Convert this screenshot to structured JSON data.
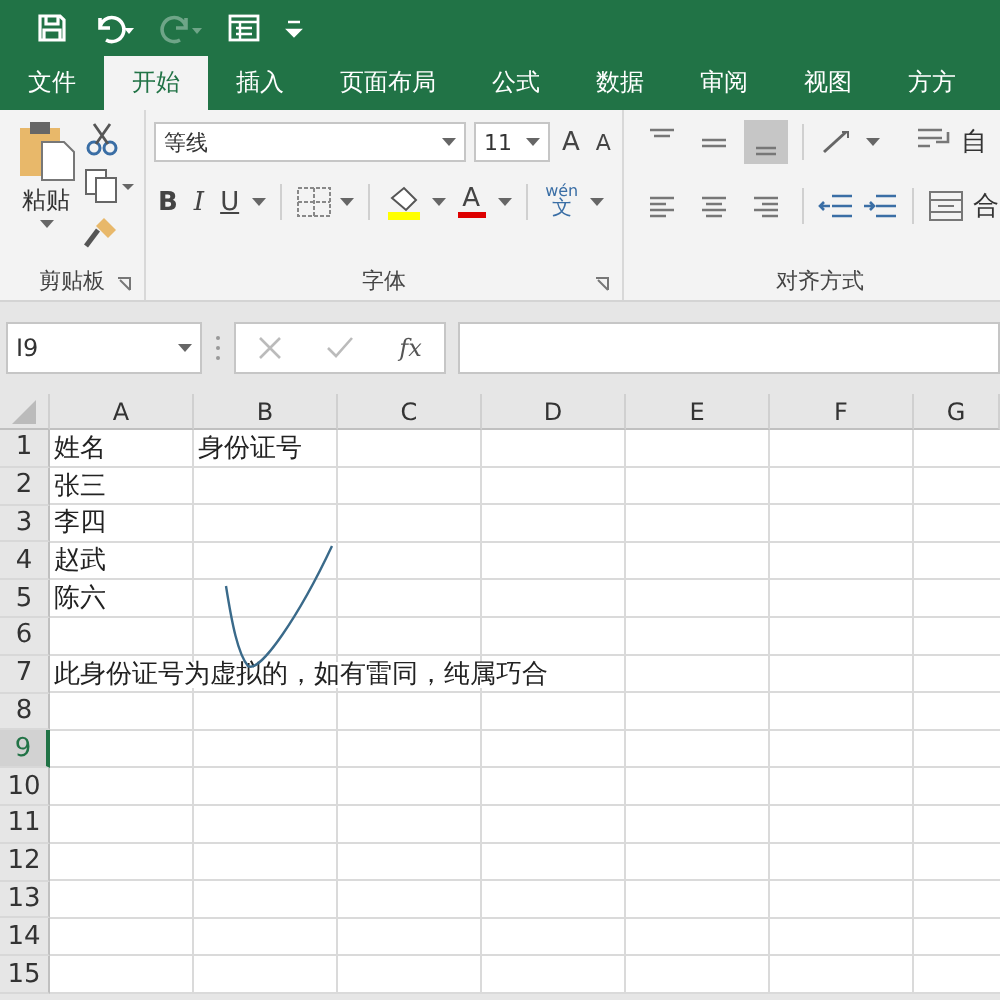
{
  "quick_access": [
    {
      "kind": "save",
      "disabled": false
    },
    {
      "kind": "undo",
      "disabled": false
    },
    {
      "kind": "redo",
      "disabled": true
    },
    {
      "kind": "form",
      "disabled": false
    },
    {
      "kind": "customize",
      "disabled": false
    }
  ],
  "tabs": [
    {
      "label": "文件",
      "selected": false
    },
    {
      "label": "开始",
      "selected": true
    },
    {
      "label": "插入",
      "selected": false
    },
    {
      "label": "页面布局",
      "selected": false
    },
    {
      "label": "公式",
      "selected": false
    },
    {
      "label": "数据",
      "selected": false
    },
    {
      "label": "审阅",
      "selected": false
    },
    {
      "label": "视图",
      "selected": false
    },
    {
      "label": "方方",
      "selected": false
    }
  ],
  "clipboard": {
    "paste_label": "粘贴",
    "group_label": "剪贴板"
  },
  "font": {
    "font_name": "等线",
    "font_size": "11",
    "grow": "A",
    "shrink": "A",
    "bold": "B",
    "italic": "I",
    "underline": "U",
    "font_color": "A",
    "phonetic_top": "wén",
    "phonetic_bottom": "文",
    "group_label": "字体"
  },
  "alignment": {
    "rows": [
      [
        {
          "kind": "top",
          "selected": false
        },
        {
          "kind": "middle",
          "selected": false
        },
        {
          "kind": "bottom",
          "selected": true
        }
      ],
      [
        {
          "kind": "left",
          "selected": false
        },
        {
          "kind": "center",
          "selected": false
        },
        {
          "kind": "right",
          "selected": false
        }
      ]
    ],
    "wrap_text": "自",
    "merge": "合",
    "group_label": "对齐方式"
  },
  "formula_bar": {
    "name_box": "I9",
    "fx": "fx"
  },
  "sheet": {
    "columns": [
      "A",
      "B",
      "C",
      "D",
      "E",
      "F",
      "G"
    ],
    "rows": [
      {
        "number": "1",
        "selected": false,
        "cells": [
          "姓名",
          "身份证号"
        ]
      },
      {
        "number": "2",
        "selected": false,
        "cells": [
          "张三"
        ]
      },
      {
        "number": "3",
        "selected": false,
        "cells": [
          "李四"
        ]
      },
      {
        "number": "4",
        "selected": false,
        "cells": [
          "赵武"
        ]
      },
      {
        "number": "5",
        "selected": false,
        "cells": [
          "陈六"
        ]
      },
      {
        "number": "6",
        "selected": false
      },
      {
        "number": "7",
        "selected": false,
        "cells": [
          "此身份证号为虚拟的，如有雷同，纯属巧合"
        ]
      },
      {
        "number": "8",
        "selected": false
      },
      {
        "number": "9",
        "selected": true
      },
      {
        "number": "10",
        "selected": false
      },
      {
        "number": "11",
        "selected": false
      },
      {
        "number": "12",
        "selected": false
      },
      {
        "number": "13",
        "selected": false
      },
      {
        "number": "14",
        "selected": false
      },
      {
        "number": "15",
        "selected": false
      }
    ]
  }
}
